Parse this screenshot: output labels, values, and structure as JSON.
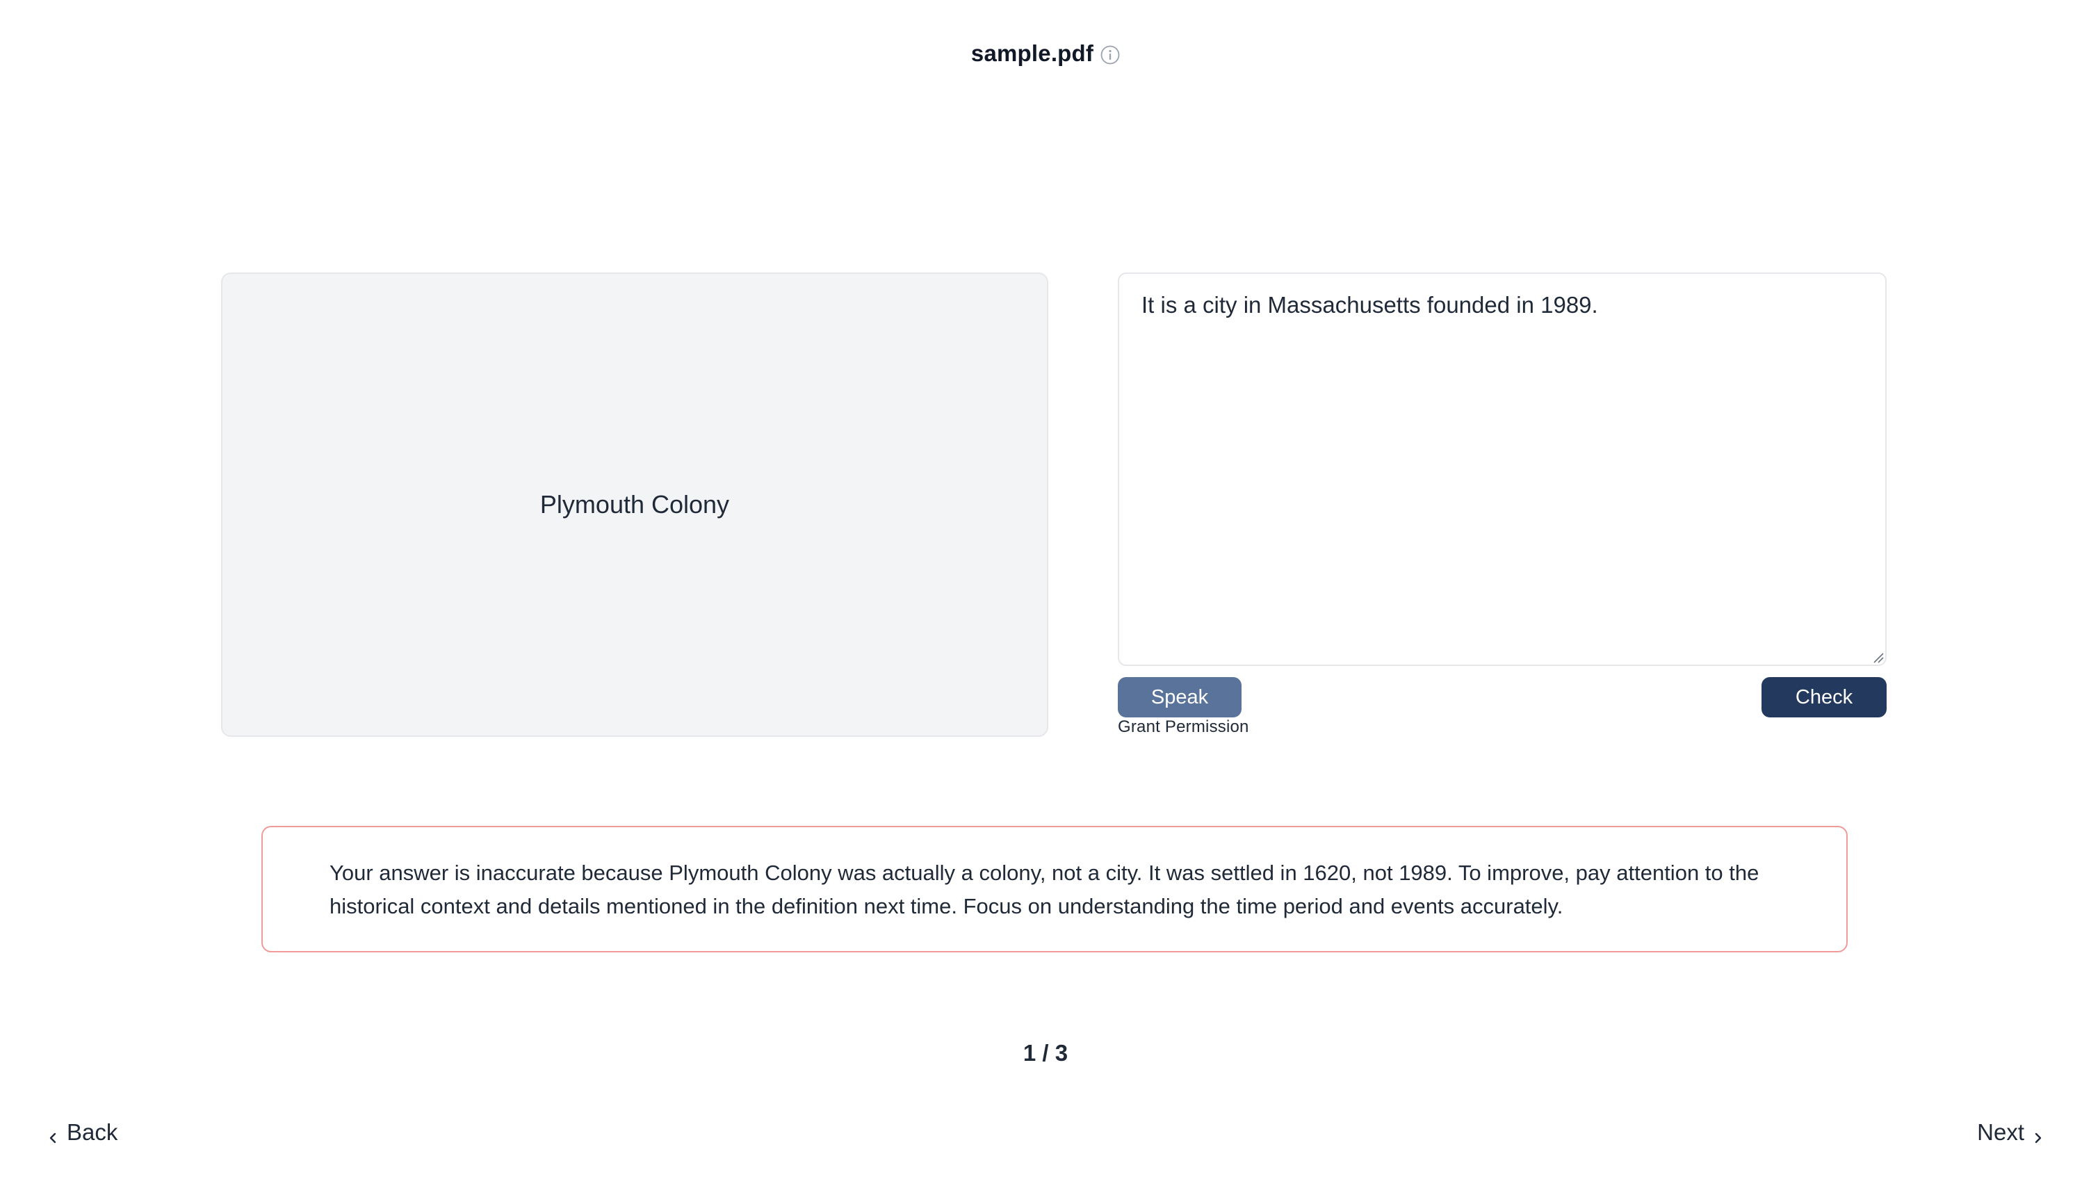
{
  "header": {
    "title": "sample.pdf",
    "info_icon": "info-circle-icon"
  },
  "card": {
    "term": "Plymouth Colony"
  },
  "answer": {
    "value": "It is a city in Massachusetts founded in 1989."
  },
  "controls": {
    "speak_label": "Speak",
    "grant_permission_label": "Grant Permission",
    "check_label": "Check"
  },
  "feedback": {
    "text": "Your answer is inaccurate because Plymouth Colony was actually a colony, not a city. It was settled in 1620, not 1989. To improve, pay attention to the historical context and details mentioned in the definition next time. Focus on understanding the time period and events accurately.",
    "border_color": "#f19a9a"
  },
  "pagination": {
    "counter": "1 / 3",
    "back_label": "Back",
    "next_label": "Next"
  },
  "colors": {
    "speak_button": "#5a739a",
    "check_button": "#233a5e",
    "card_background": "#f3f4f6"
  }
}
